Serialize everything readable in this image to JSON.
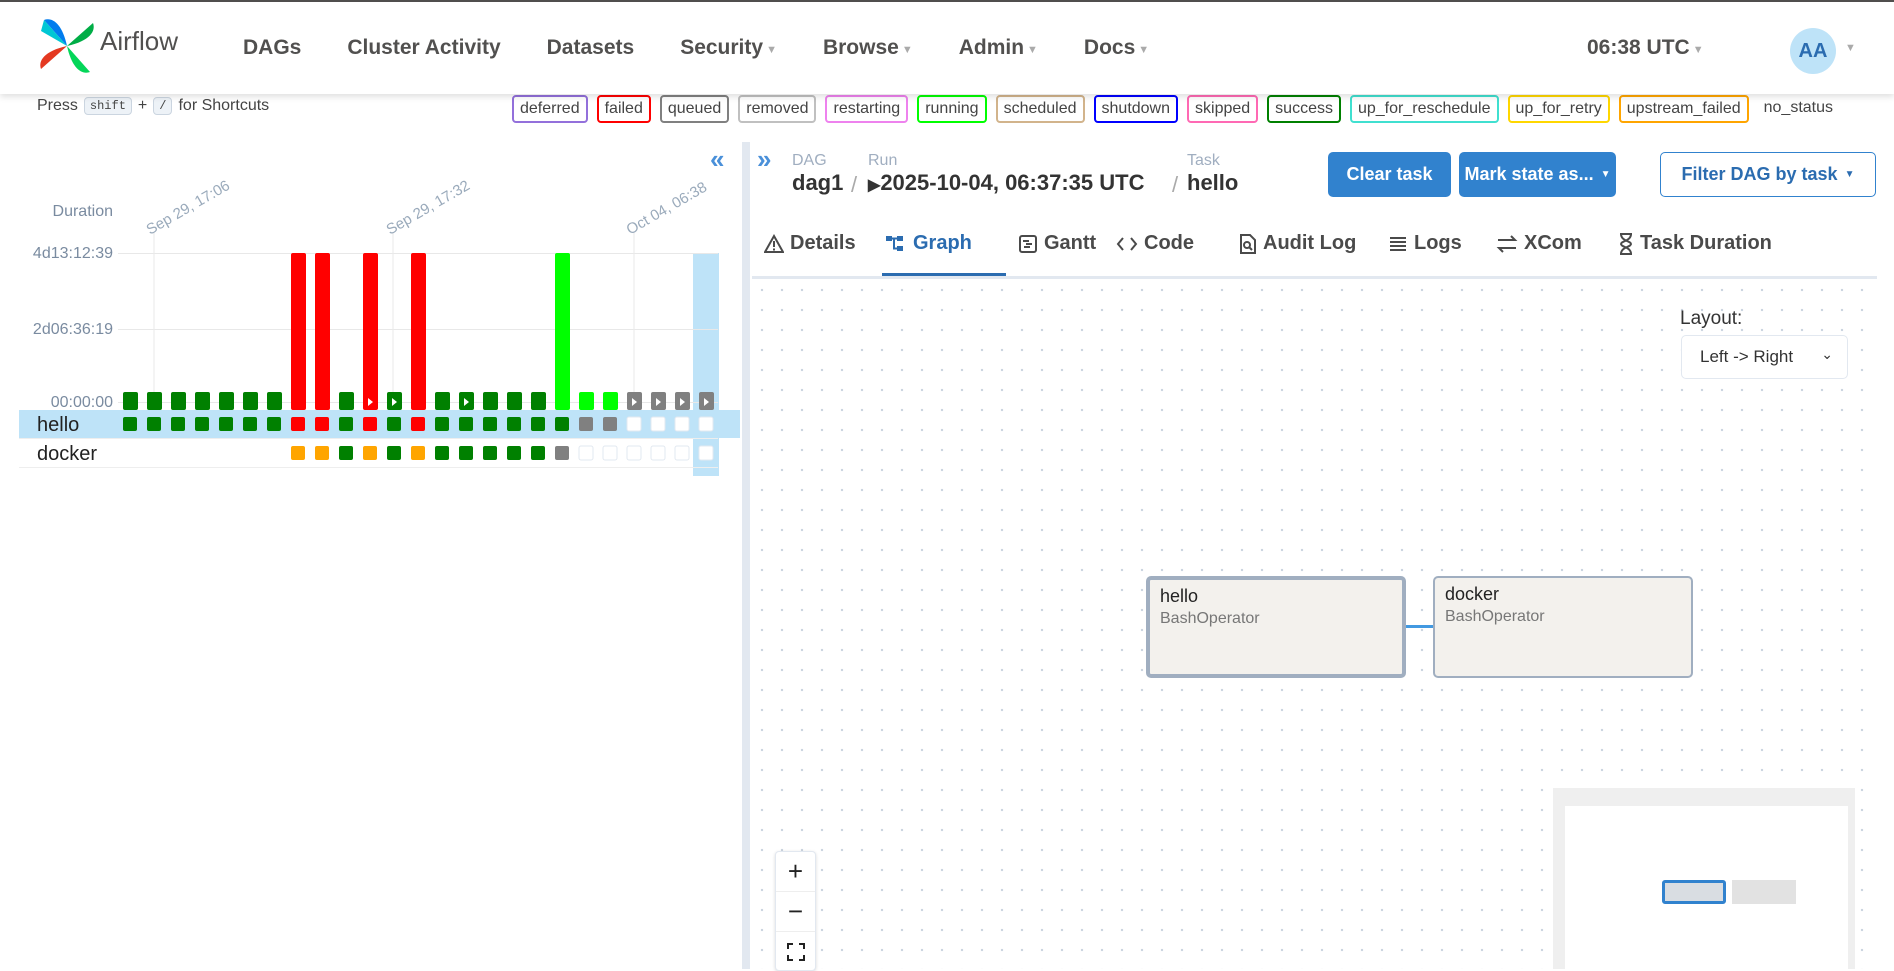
{
  "app": {
    "name": "Airflow"
  },
  "nav": {
    "items": [
      {
        "label": "DAGs",
        "caret": false
      },
      {
        "label": "Cluster Activity",
        "caret": false
      },
      {
        "label": "Datasets",
        "caret": false
      },
      {
        "label": "Security",
        "caret": true
      },
      {
        "label": "Browse",
        "caret": true
      },
      {
        "label": "Admin",
        "caret": true
      },
      {
        "label": "Docs",
        "caret": true
      }
    ],
    "clock": "06:38 UTC",
    "avatar": "AA"
  },
  "shortcuts": {
    "press": "Press",
    "key1": "shift",
    "plus": "+",
    "key2": "/",
    "suffix": "for Shortcuts"
  },
  "legend": [
    {
      "label": "deferred",
      "color": "#9370db"
    },
    {
      "label": "failed",
      "color": "#ff0000"
    },
    {
      "label": "queued",
      "color": "#808080"
    },
    {
      "label": "removed",
      "color": "#c0c0c0"
    },
    {
      "label": "restarting",
      "color": "#ee82ee"
    },
    {
      "label": "running",
      "color": "#00ff00"
    },
    {
      "label": "scheduled",
      "color": "#d2b48c"
    },
    {
      "label": "shutdown",
      "color": "#0000ff"
    },
    {
      "label": "skipped",
      "color": "#ff69b4"
    },
    {
      "label": "success",
      "color": "#008000"
    },
    {
      "label": "up_for_reschedule",
      "color": "#40e0d0"
    },
    {
      "label": "up_for_retry",
      "color": "#ffd700"
    },
    {
      "label": "upstream_failed",
      "color": "#ffa500"
    },
    {
      "label": "no_status",
      "color": null
    }
  ],
  "grid": {
    "duration_label": "Duration",
    "y_ticks": [
      "4d13:12:39",
      "2d06:36:19",
      "00:00:00"
    ],
    "date_labels": [
      "Sep 29, 17:06",
      "Sep 29, 17:32",
      "Oct 04, 06:38"
    ],
    "runs": [
      {
        "state": "success",
        "dur": 0.04,
        "play": false
      },
      {
        "state": "success",
        "dur": 0.04,
        "play": false
      },
      {
        "state": "success",
        "dur": 0.04,
        "play": false
      },
      {
        "state": "success",
        "dur": 0.04,
        "play": false
      },
      {
        "state": "success",
        "dur": 0.04,
        "play": false
      },
      {
        "state": "success",
        "dur": 0.04,
        "play": false
      },
      {
        "state": "success",
        "dur": 0.04,
        "play": false
      },
      {
        "state": "failed",
        "dur": 1.0,
        "play": false
      },
      {
        "state": "failed",
        "dur": 1.0,
        "play": false
      },
      {
        "state": "success",
        "dur": 0.04,
        "play": false
      },
      {
        "state": "failed",
        "dur": 1.0,
        "play": true
      },
      {
        "state": "success",
        "dur": 0.04,
        "play": true
      },
      {
        "state": "failed",
        "dur": 1.0,
        "play": false
      },
      {
        "state": "success",
        "dur": 0.04,
        "play": false
      },
      {
        "state": "success",
        "dur": 0.04,
        "play": true
      },
      {
        "state": "success",
        "dur": 0.04,
        "play": false
      },
      {
        "state": "success",
        "dur": 0.04,
        "play": false
      },
      {
        "state": "success",
        "dur": 0.04,
        "play": false
      },
      {
        "state": "running",
        "dur": 1.0,
        "play": false
      },
      {
        "state": "running",
        "dur": 0.04,
        "play": false
      },
      {
        "state": "running",
        "dur": 0.04,
        "play": false
      },
      {
        "state": "queued",
        "dur": 0.04,
        "play": true
      },
      {
        "state": "queued",
        "dur": 0.04,
        "play": true
      },
      {
        "state": "queued",
        "dur": 0.04,
        "play": true
      },
      {
        "state": "queued",
        "dur": 0.04,
        "play": true
      }
    ],
    "tasks": [
      {
        "name": "hello",
        "states": [
          "success",
          "success",
          "success",
          "success",
          "success",
          "success",
          "success",
          "failed",
          "failed",
          "success",
          "failed",
          "success",
          "failed",
          "success",
          "success",
          "success",
          "success",
          "success",
          "success",
          "queued",
          "queued",
          "none",
          "none",
          "none",
          "none"
        ]
      },
      {
        "name": "docker",
        "states": [
          "",
          "",
          "",
          "",
          "",
          "",
          "",
          "upstream_failed",
          "upstream_failed",
          "success",
          "upstream_failed",
          "success",
          "upstream_failed",
          "success",
          "success",
          "success",
          "success",
          "success",
          "queued",
          "none",
          "none",
          "none",
          "none",
          "none",
          "none"
        ]
      }
    ]
  },
  "breadcrumb": {
    "dag_label": "DAG",
    "dag": "dag1",
    "run_label": "Run",
    "run": "2025-10-04, 06:37:35 UTC",
    "task_label": "Task",
    "task": "hello",
    "sep": "/"
  },
  "actions": {
    "clear": "Clear task",
    "mark": "Mark state as...",
    "filter": "Filter DAG by task"
  },
  "tabs": [
    {
      "label": "Details",
      "icon": "warning-icon",
      "active": false
    },
    {
      "label": "Graph",
      "icon": "graph-icon",
      "active": true
    },
    {
      "label": "Gantt",
      "icon": "gantt-icon",
      "active": false
    },
    {
      "label": "Code",
      "icon": "code-icon",
      "active": false
    },
    {
      "label": "Audit Log",
      "icon": "audit-log-icon",
      "active": false
    },
    {
      "label": "Logs",
      "icon": "logs-icon",
      "active": false
    },
    {
      "label": "XCom",
      "icon": "xcom-icon",
      "active": false
    },
    {
      "label": "Task Duration",
      "icon": "hourglass-icon",
      "active": false
    }
  ],
  "graph": {
    "layout_label": "Layout:",
    "layout_value": "Left -> Right",
    "nodes": [
      {
        "id": "hello",
        "operator": "BashOperator",
        "selected": true
      },
      {
        "id": "docker",
        "operator": "BashOperator",
        "selected": false
      }
    ]
  },
  "zoom": {
    "plus": "+",
    "minus": "−"
  },
  "colors": {
    "success": "#008000",
    "failed": "#ff0000",
    "running": "#00ff00",
    "queued": "#808080",
    "upstream_failed": "#ffa500",
    "accent": "#3182ce"
  }
}
